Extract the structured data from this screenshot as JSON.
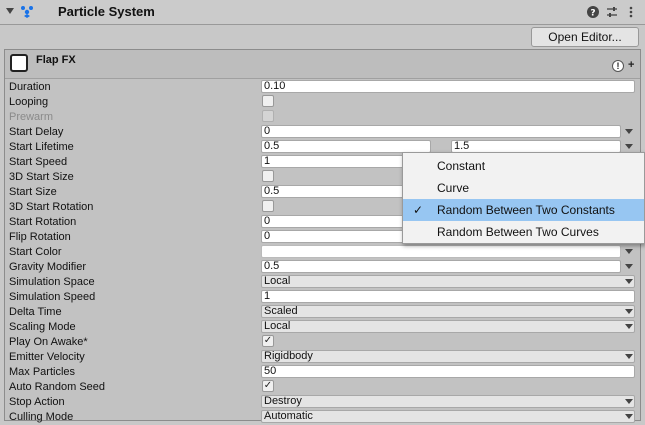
{
  "component": {
    "title": "Particle System",
    "open_editor_label": "Open Editor...",
    "header_icons": [
      "help-icon",
      "settings-sliders-icon",
      "more-icon"
    ]
  },
  "module": {
    "title": "Flap FX",
    "swatch_color": "#ffffff"
  },
  "props": {
    "duration": {
      "label": "Duration",
      "value": "0.10"
    },
    "looping": {
      "label": "Looping",
      "checked": false
    },
    "prewarm": {
      "label": "Prewarm",
      "checked": false,
      "disabled": true
    },
    "start_delay": {
      "label": "Start Delay",
      "value": "0"
    },
    "start_lifetime": {
      "label": "Start Lifetime",
      "min": "0.5",
      "max": "1.5"
    },
    "start_speed": {
      "label": "Start Speed",
      "value": "1"
    },
    "start_size_3d": {
      "label": "3D Start Size",
      "checked": false
    },
    "start_size": {
      "label": "Start Size",
      "value": "0.5"
    },
    "start_rotation_3d": {
      "label": "3D Start Rotation",
      "checked": false
    },
    "start_rotation": {
      "label": "Start Rotation",
      "value": "0"
    },
    "flip_rotation": {
      "label": "Flip Rotation",
      "value": "0"
    },
    "start_color": {
      "label": "Start Color",
      "color": "#ffffff"
    },
    "gravity_modifier": {
      "label": "Gravity Modifier",
      "value": "0.5"
    },
    "simulation_space": {
      "label": "Simulation Space",
      "value": "Local"
    },
    "simulation_speed": {
      "label": "Simulation Speed",
      "value": "1"
    },
    "delta_time": {
      "label": "Delta Time",
      "value": "Scaled"
    },
    "scaling_mode": {
      "label": "Scaling Mode",
      "value": "Local"
    },
    "play_on_awake": {
      "label": "Play On Awake*",
      "checked": true
    },
    "emitter_velocity": {
      "label": "Emitter Velocity",
      "value": "Rigidbody"
    },
    "max_particles": {
      "label": "Max Particles",
      "value": "50"
    },
    "auto_random_seed": {
      "label": "Auto Random Seed",
      "checked": true
    },
    "stop_action": {
      "label": "Stop Action",
      "value": "Destroy"
    },
    "culling_mode": {
      "label": "Culling Mode",
      "value": "Automatic"
    }
  },
  "mode_menu": {
    "items": [
      {
        "label": "Constant",
        "selected": false
      },
      {
        "label": "Curve",
        "selected": false
      },
      {
        "label": "Random Between Two Constants",
        "selected": true
      },
      {
        "label": "Random Between Two Curves",
        "selected": false
      }
    ],
    "selected_color": "#97c6f2"
  },
  "colors": {
    "panel": "#c2c2c2",
    "accent": "#1a73e8"
  }
}
